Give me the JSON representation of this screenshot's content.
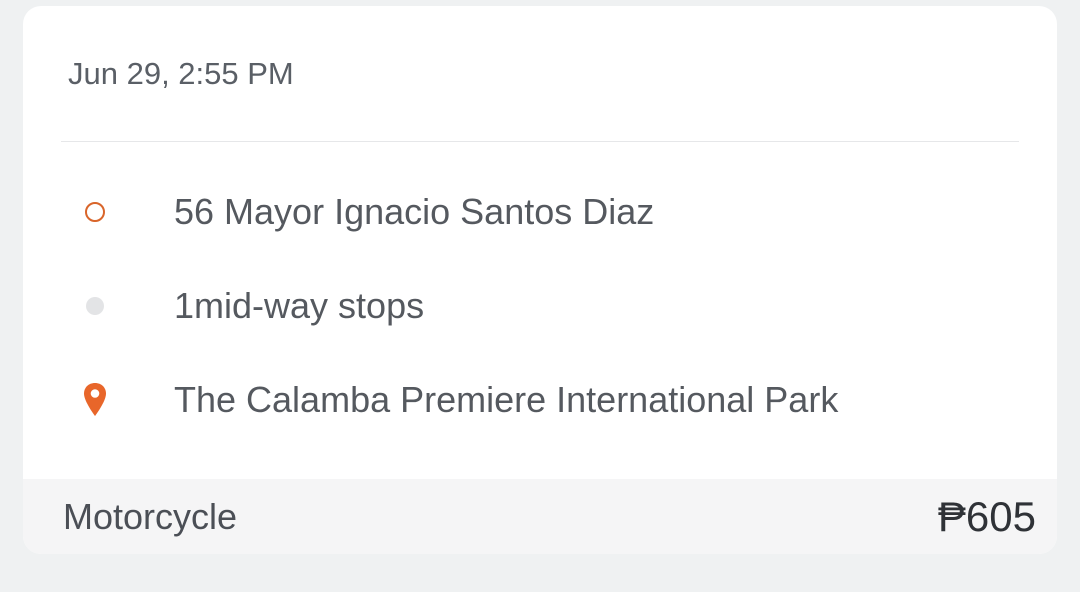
{
  "trip": {
    "datetime": "Jun 29, 2:55 PM",
    "stops": [
      {
        "icon": "pickup-ring-icon",
        "label": "56 Mayor Ignacio Santos Diaz"
      },
      {
        "icon": "midway-dot-icon",
        "label": "1mid-way stops"
      },
      {
        "icon": "location-pin-icon",
        "label": "The Calamba Premiere International Park"
      }
    ],
    "vehicle": "Motorcycle",
    "price": "₱605"
  },
  "colors": {
    "accent": "#d9652a",
    "pin": "#e8662a",
    "background": "#eff1f2",
    "card": "#ffffff",
    "footer": "#f5f5f6"
  }
}
